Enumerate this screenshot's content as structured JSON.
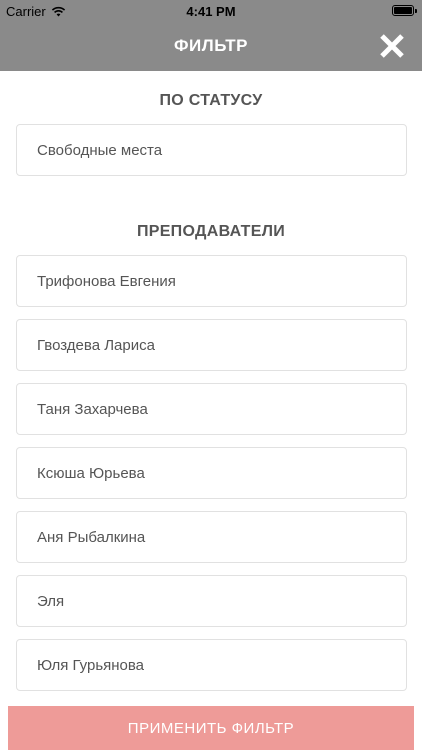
{
  "status_bar": {
    "carrier": "Carrier",
    "time": "4:41 PM",
    "battery_level": 1.0
  },
  "header": {
    "title": "ФИЛЬТР",
    "close_icon": "close-icon"
  },
  "status_section": {
    "title": "ПО СТАТУСУ",
    "items": [
      {
        "label": "Свободные места"
      }
    ]
  },
  "teachers_section": {
    "title": "ПРЕПОДАВАТЕЛИ",
    "items": [
      {
        "label": "Трифонова Евгения"
      },
      {
        "label": "Гвоздева Лариса"
      },
      {
        "label": "Таня Захарчева"
      },
      {
        "label": "Ксюша Юрьева"
      },
      {
        "label": "Аня Рыбалкина"
      },
      {
        "label": "Эля"
      },
      {
        "label": "Юля Гурьянова"
      }
    ]
  },
  "apply_button": {
    "label": "ПРИМЕНИТЬ ФИЛЬТР"
  },
  "colors": {
    "header_bg": "#8a8a8a",
    "apply_bg": "#ee9b98",
    "text": "#555555",
    "border": "#e1e1e1"
  }
}
